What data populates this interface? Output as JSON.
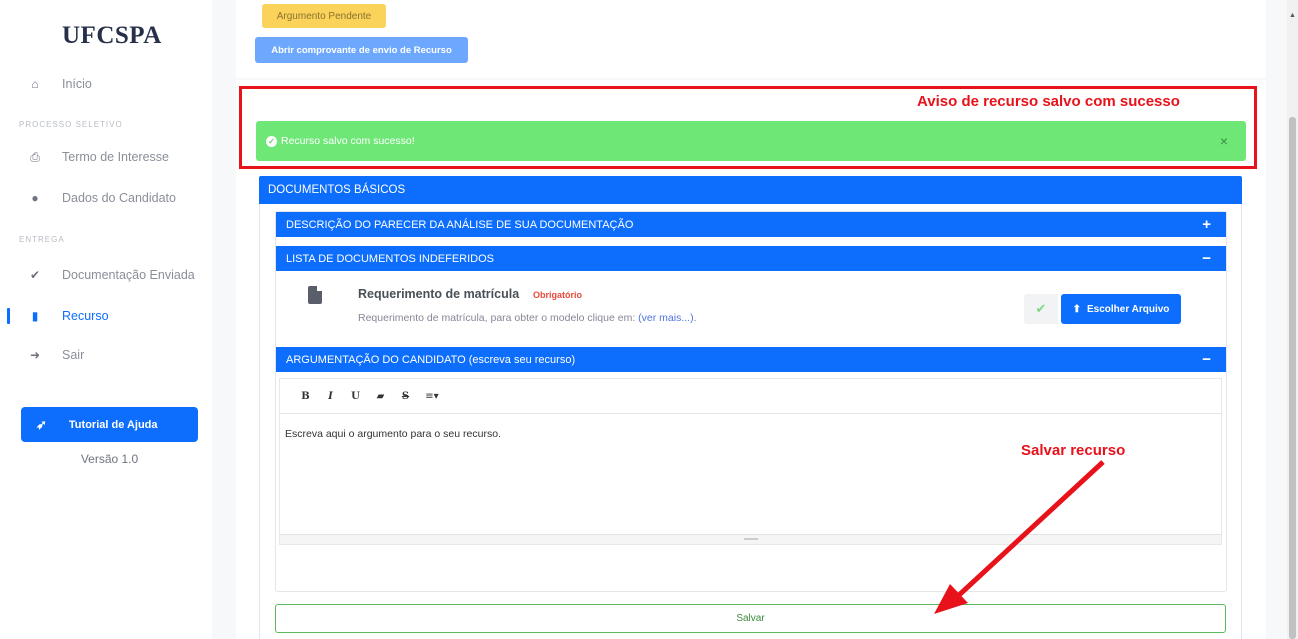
{
  "sidebar": {
    "logo": "UFCSPA",
    "items": [
      {
        "label": "Início",
        "icon": "home-icon",
        "glyph": "⌂"
      },
      {
        "label": "Termo de Interesse",
        "icon": "print-icon",
        "glyph": "⎙"
      },
      {
        "label": "Dados do Candidato",
        "icon": "user-icon",
        "glyph": "●"
      },
      {
        "label": "Documentação Enviada",
        "icon": "check-icon",
        "glyph": "✔"
      },
      {
        "label": "Recurso",
        "icon": "clipboard-icon",
        "glyph": "▮"
      },
      {
        "label": "Sair",
        "icon": "sign-out-icon",
        "glyph": "➜"
      }
    ],
    "sections": [
      "PROCESSO SELETIVO",
      "ENTREGA"
    ],
    "help_button": "Tutorial de Ajuda",
    "version": "Versão 1.0"
  },
  "header": {
    "pending_badge": "Argumento Pendente",
    "receipt_button": "Abrir comprovante de envio de Recurso"
  },
  "alert": {
    "message": "Recurso salvo com sucesso!",
    "close": "×",
    "color": "#6ee777"
  },
  "annotations": {
    "alert_note": "Aviso de recurso salvo com sucesso",
    "save_note": "Salvar recurso",
    "color": "#e8121b"
  },
  "documents": {
    "header": "DOCUMENTOS BÁSICOS",
    "sections": [
      {
        "label": "DESCRIÇÃO DO PARECER DA ANÁLISE DE SUA DOCUMENTAÇÃO",
        "sign": "+"
      },
      {
        "label": "LISTA DE DOCUMENTOS INDEFERIDOS",
        "sign": "−"
      },
      {
        "label": "ARGUMENTAÇÃO DO CANDIDATO (escreva seu recurso)",
        "sign": "−"
      }
    ],
    "requirement": {
      "title": "Requerimento de matrícula",
      "badge": "Obrigatório",
      "description": "Requerimento de matrícula, para obter o modelo clique em:",
      "link": "(ver mais...)",
      "link_suffix": ".",
      "choose_button": "Escolher Arquivo"
    }
  },
  "editor": {
    "toolbar": [
      "B",
      "I",
      "U",
      "▰",
      "S",
      "≡▾"
    ],
    "text": "Escreva aqui o argumento para o seu recurso."
  },
  "save_button": "Salvar",
  "colors": {
    "primary": "#0d6efd",
    "warning": "#fbd35a",
    "success_border": "#5cb85c"
  }
}
